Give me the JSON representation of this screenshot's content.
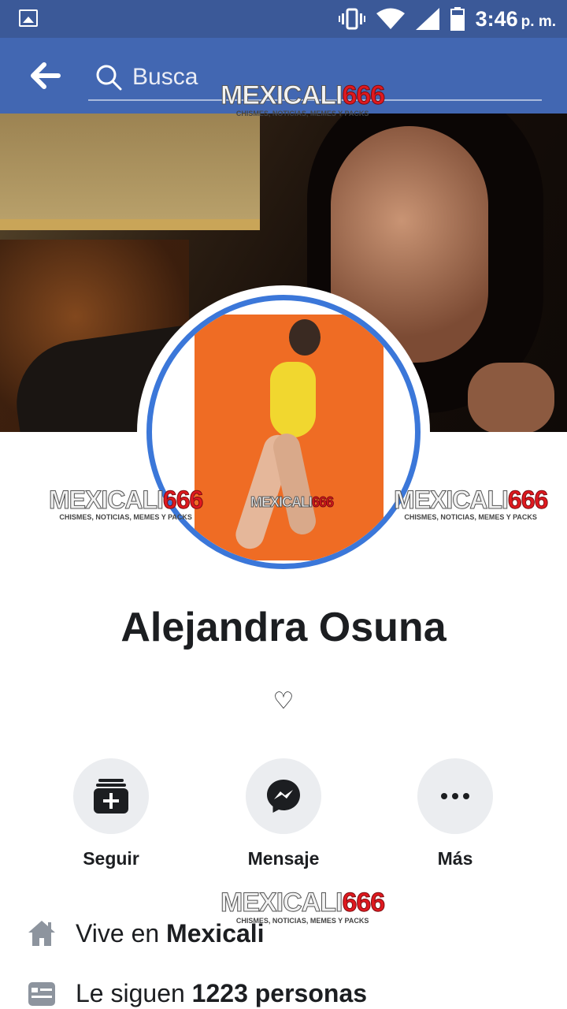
{
  "status_bar": {
    "time": "3:46",
    "ampm": "p. m.",
    "icons": [
      "image-notification-icon",
      "vibrate-icon",
      "wifi-icon",
      "signal-icon",
      "battery-icon"
    ]
  },
  "header": {
    "search_placeholder": "Busca"
  },
  "watermark": {
    "brand_a": "MEXICALI",
    "brand_b": "666",
    "tagline": "CHISMES, NOTICIAS, MEMES Y PACKS"
  },
  "profile": {
    "name": "Alejandra Osuna",
    "bio": "♡"
  },
  "actions": [
    {
      "label": "Seguir",
      "icon": "follow-icon"
    },
    {
      "label": "Mensaje",
      "icon": "messenger-icon"
    },
    {
      "label": "Más",
      "icon": "more-icon"
    }
  ],
  "info": {
    "lives_prefix": "Vive en ",
    "lives_city": "Mexicali",
    "followers_prefix": "Le siguen ",
    "followers_count": "1223 personas"
  },
  "colors": {
    "status_bar": "#3b5998",
    "header": "#4267b2",
    "avatar_ring": "#3b77d9",
    "action_bg": "#ebedf0"
  }
}
